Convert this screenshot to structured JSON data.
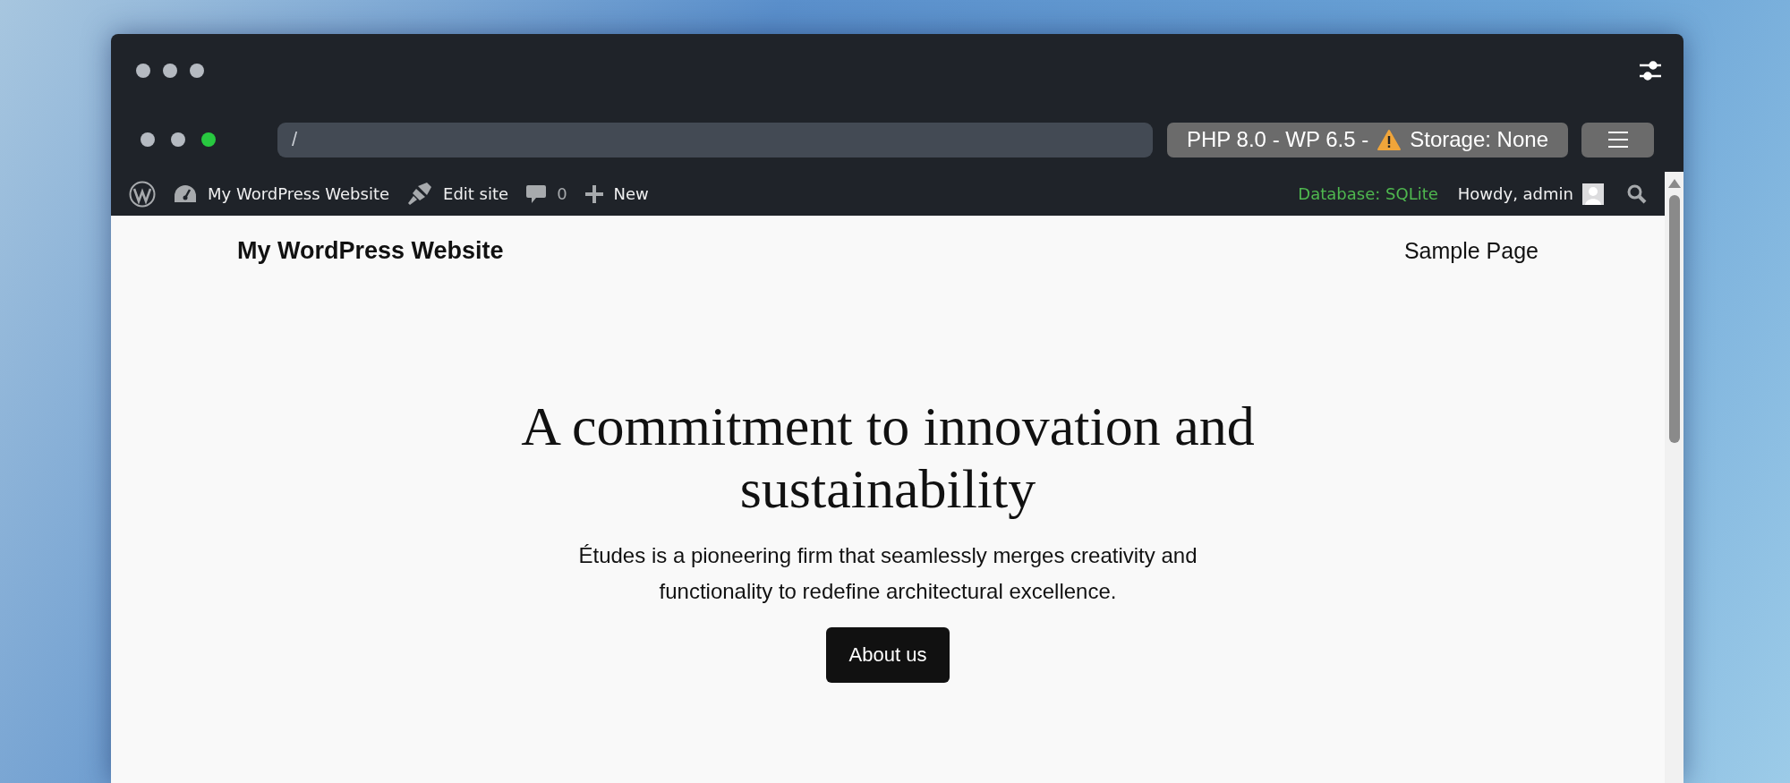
{
  "browser": {
    "address": "/",
    "badge_before": "PHP 8.0 - WP 6.5 -",
    "badge_after": "Storage: None"
  },
  "admin_bar": {
    "items": [
      {
        "kind": "logo"
      },
      {
        "kind": "site",
        "label": "My WordPress Website"
      },
      {
        "kind": "edit",
        "label": "Edit site"
      },
      {
        "kind": "comments",
        "label": "0"
      },
      {
        "kind": "new",
        "label": "New"
      }
    ],
    "database": "Database: SQLite",
    "greeting": "Howdy, admin"
  },
  "site": {
    "title": "My WordPress Website",
    "nav": [
      "Sample Page"
    ]
  },
  "hero": {
    "heading": "A commitment to innovation and sustainability",
    "text": "Études is a pioneering firm that seamlessly merges creativity and functionality to redefine architectural excellence.",
    "button": "About us"
  }
}
